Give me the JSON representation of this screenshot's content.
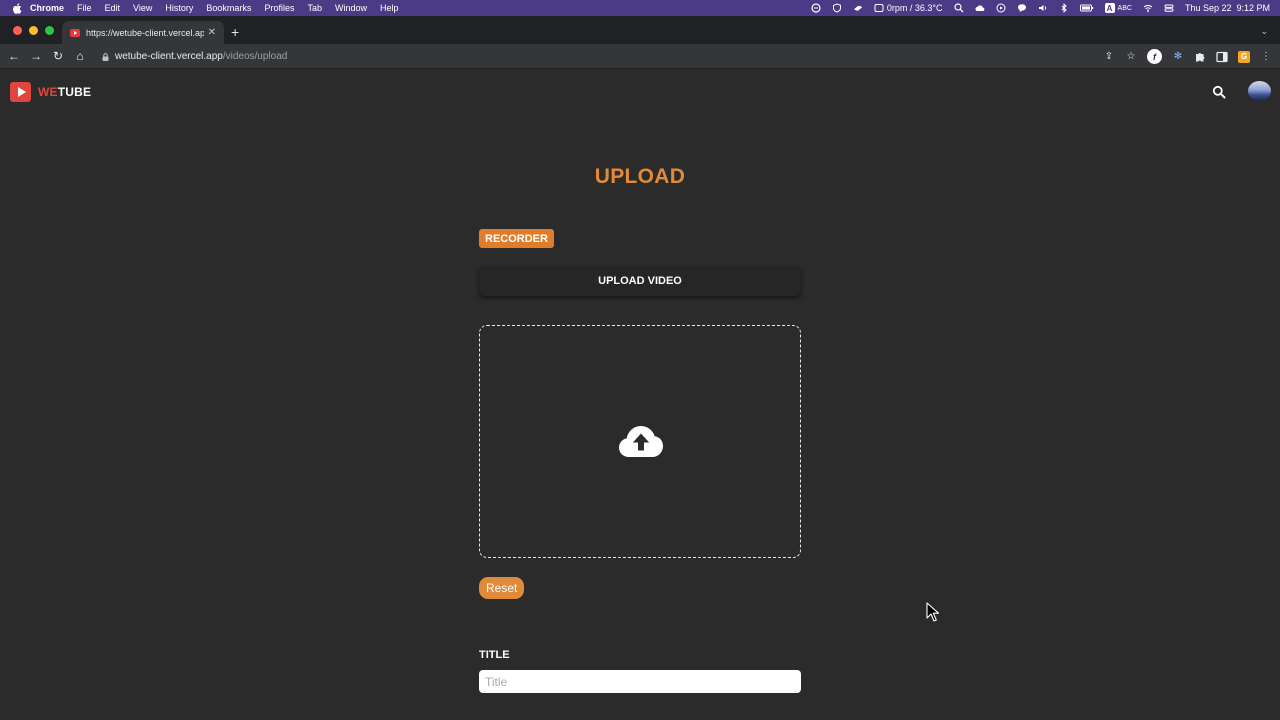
{
  "menubar": {
    "app_name": "Chrome",
    "items": [
      "File",
      "Edit",
      "View",
      "History",
      "Bookmarks",
      "Profiles",
      "Tab",
      "Window",
      "Help"
    ],
    "status_text": "0rpm / 36.3°C",
    "input_source": "ABC",
    "clock": "Thu Sep 22  9:12 PM"
  },
  "browser": {
    "tab_title": "https://wetube-client.vercel.app",
    "new_tab_label": "+",
    "address_host": "wetube-client.vercel.app",
    "address_path": "/videos/upload",
    "profile_initial": "f"
  },
  "site": {
    "logo_we": "WE",
    "logo_tube": "TUBE",
    "brand_color": "#e0463d"
  },
  "upload": {
    "heading": "UPLOAD",
    "recorder_label": "RECORDER",
    "upload_video_label": "UPLOAD VIDEO",
    "reset_label": "Reset",
    "title_label": "TITLE",
    "title_placeholder": "Title",
    "title_value": "",
    "accent_color": "#e08a3a"
  }
}
